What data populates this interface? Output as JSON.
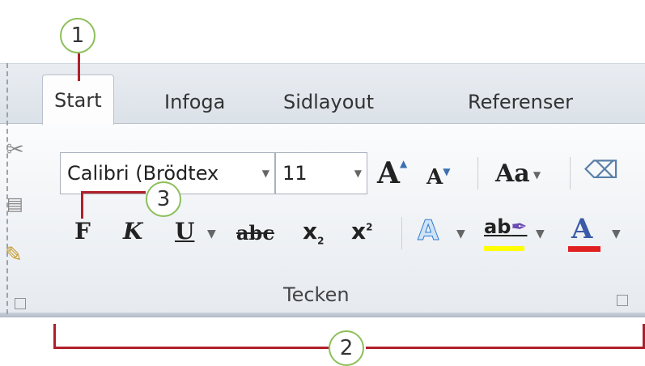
{
  "tabs": [
    {
      "label": "Start"
    },
    {
      "label": "Infoga"
    },
    {
      "label": "Sidlayout"
    },
    {
      "label": "Referenser"
    }
  ],
  "font_group": {
    "font_name": "Calibri (Brödtex",
    "font_size": "11",
    "label": "Tecken"
  },
  "callouts": [
    "1",
    "2",
    "3"
  ],
  "buttons": {
    "bold": "F",
    "italic": "K",
    "underline": "U",
    "strikethrough": "abc",
    "subscript": "x",
    "subscript_mark": "2",
    "superscript": "x",
    "superscript_mark": "2",
    "grow": "A",
    "shrink": "A",
    "change_case": "Aa",
    "text_effects": "A",
    "highlight": "ab",
    "font_color": "A"
  },
  "colors": {
    "callout_border": "#8cbf5a",
    "callout_line": "#b0202a",
    "highlight_yellow": "#ffff00",
    "font_color_red": "#e02020"
  }
}
